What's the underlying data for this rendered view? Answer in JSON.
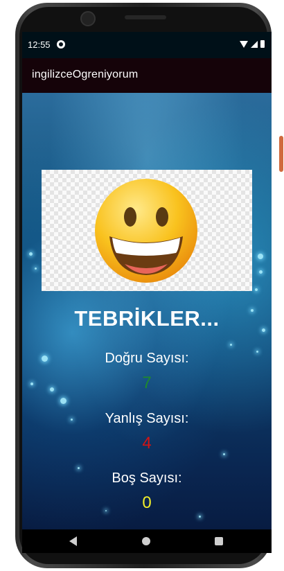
{
  "status_bar": {
    "time": "12:55",
    "icons": [
      "notification-icon",
      "wifi-icon",
      "signal-icon",
      "battery-icon"
    ]
  },
  "app_bar": {
    "title": "ingilizceOgreniyorum"
  },
  "result": {
    "image": "grinning-face-emoji",
    "headline": "TEBRİKLER...",
    "correct": {
      "label": "Doğru Sayısı:",
      "value": "7",
      "color": "#1f8a2c"
    },
    "wrong": {
      "label": "Yanlış Sayısı:",
      "value": "4",
      "color": "#d31414"
    },
    "empty": {
      "label": "Boş Sayısı:",
      "value": "0",
      "color": "#f2ef2a"
    }
  },
  "nav_bar": {
    "icons": [
      "back-icon",
      "home-icon",
      "recent-apps-icon"
    ]
  },
  "colors": {
    "app_bar": "#150309",
    "status_bar": "#001018",
    "background_top": "#2b6c9c",
    "background_bottom": "#081c42"
  }
}
